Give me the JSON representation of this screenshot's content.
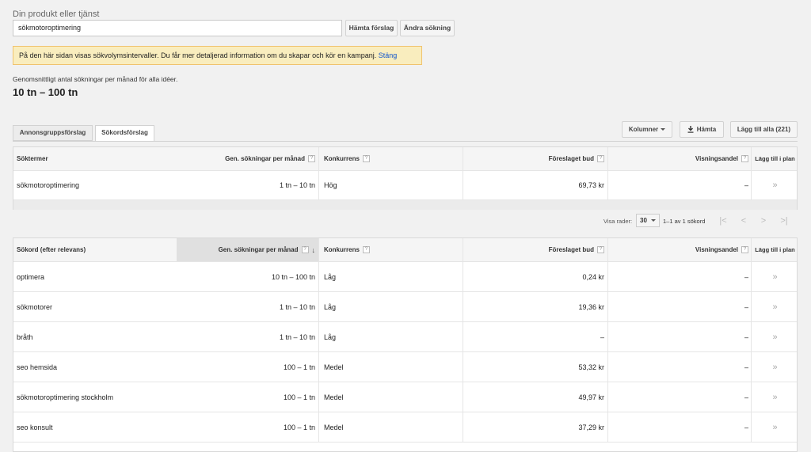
{
  "search": {
    "label": "Din produkt eller tjänst",
    "value": "sökmotoroptimering",
    "fetch_button": "Hämta förslag",
    "change_button": "Ändra sökning"
  },
  "notice": {
    "text": "På den här sidan visas sökvolymsintervaller. Du får mer detaljerad information om du skapar och kör en kampanj.",
    "link": "Stäng"
  },
  "summary": {
    "label": "Genomsnittligt antal sökningar per månad för alla idéer.",
    "value": "10 tn – 100 tn"
  },
  "tabs": [
    {
      "label": "Annonsgruppsförslag",
      "active": false
    },
    {
      "label": "Sökordsförslag",
      "active": true
    }
  ],
  "toolbar": {
    "columns": "Kolumner",
    "download": "Hämta",
    "add_all": "Lägg till alla (221)"
  },
  "search_terms_table": {
    "headers": {
      "keyword": "Söktermer",
      "avg": "Gen. sökningar per månad",
      "competition": "Konkurrens",
      "bid": "Föreslaget bud",
      "share": "Visningsandel",
      "add": "Lägg till i plan"
    },
    "rows": [
      {
        "keyword": "sökmotoroptimering",
        "avg": "1 tn – 10 tn",
        "competition": "Hög",
        "bid": "69,73 kr",
        "share": "–",
        "add": "»"
      }
    ]
  },
  "pagination": {
    "label": "Visa rader:",
    "rows_value": "30",
    "range": "1–1 av 1 sökord",
    "first": "|<",
    "prev": "<",
    "next": ">",
    "last": ">|"
  },
  "keyword_table": {
    "headers": {
      "keyword": "Sökord (efter relevans)",
      "avg": "Gen. sökningar per månad",
      "competition": "Konkurrens",
      "bid": "Föreslaget bud",
      "share": "Visningsandel",
      "add": "Lägg till i plan"
    },
    "help": "?",
    "sort_arrow": "↓",
    "rows": [
      {
        "keyword": "optimera",
        "avg": "10 tn – 100 tn",
        "competition": "Låg",
        "bid": "0,24 kr",
        "share": "–",
        "add": "»"
      },
      {
        "keyword": "sökmotorer",
        "avg": "1 tn – 10 tn",
        "competition": "Låg",
        "bid": "19,36 kr",
        "share": "–",
        "add": "»"
      },
      {
        "keyword": "bråth",
        "avg": "1 tn – 10 tn",
        "competition": "Låg",
        "bid": "–",
        "share": "–",
        "add": "»"
      },
      {
        "keyword": "seo hemsida",
        "avg": "100 – 1 tn",
        "competition": "Medel",
        "bid": "53,32 kr",
        "share": "–",
        "add": "»"
      },
      {
        "keyword": "sökmotoroptimering stockholm",
        "avg": "100 – 1 tn",
        "competition": "Medel",
        "bid": "49,97 kr",
        "share": "–",
        "add": "»"
      },
      {
        "keyword": "seo konsult",
        "avg": "100 – 1 tn",
        "competition": "Medel",
        "bid": "37,29 kr",
        "share": "–",
        "add": "»"
      }
    ]
  }
}
